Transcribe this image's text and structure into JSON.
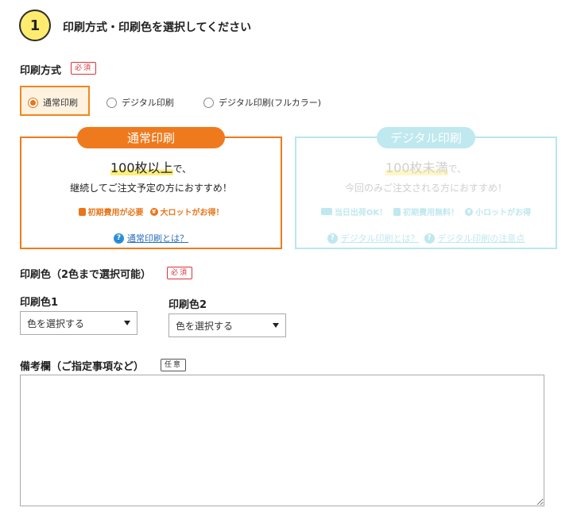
{
  "step": {
    "number": "1",
    "title": "印刷方式・印刷色を選択してください"
  },
  "print_method": {
    "label": "印刷方式",
    "required_badge": "必須",
    "options": [
      {
        "label": "通常印刷",
        "selected": true
      },
      {
        "label": "デジタル印刷",
        "selected": false
      },
      {
        "label": "デジタル印刷(フルカラー)",
        "selected": false
      }
    ]
  },
  "card_normal": {
    "tab": "通常印刷",
    "headline_hl": "100枚以上",
    "headline_suffix": "で、",
    "sub": "継続してご注文予定の方におすすめ！",
    "features": [
      "初期費用が必要",
      "大ロットがお得！"
    ],
    "link": "通常印刷とは？"
  },
  "card_digital": {
    "tab": "デジタル印刷",
    "headline_hl": "100枚未満",
    "headline_suffix": "で、",
    "sub": "今回のみご注文される方におすすめ！",
    "features": [
      "当日出荷OK！",
      "初期費用無料！",
      "小ロットがお得"
    ],
    "links": [
      "デジタル印刷とは？",
      "デジタル印刷の注意点"
    ]
  },
  "print_color": {
    "label": "印刷色（2色まで選択可能）",
    "required_badge": "必須",
    "color1_label": "印刷色1",
    "color2_label": "印刷色2",
    "color1_value": "色を選択する",
    "color2_value": "色を選択する"
  },
  "remarks": {
    "label": "備考欄（ご指定事項など）",
    "optional_badge": "任意"
  },
  "colors": {
    "accent": "#ef7a1d",
    "digital": "#bfe8ef",
    "link": "#2a6ebd",
    "required": "#d9343a"
  }
}
